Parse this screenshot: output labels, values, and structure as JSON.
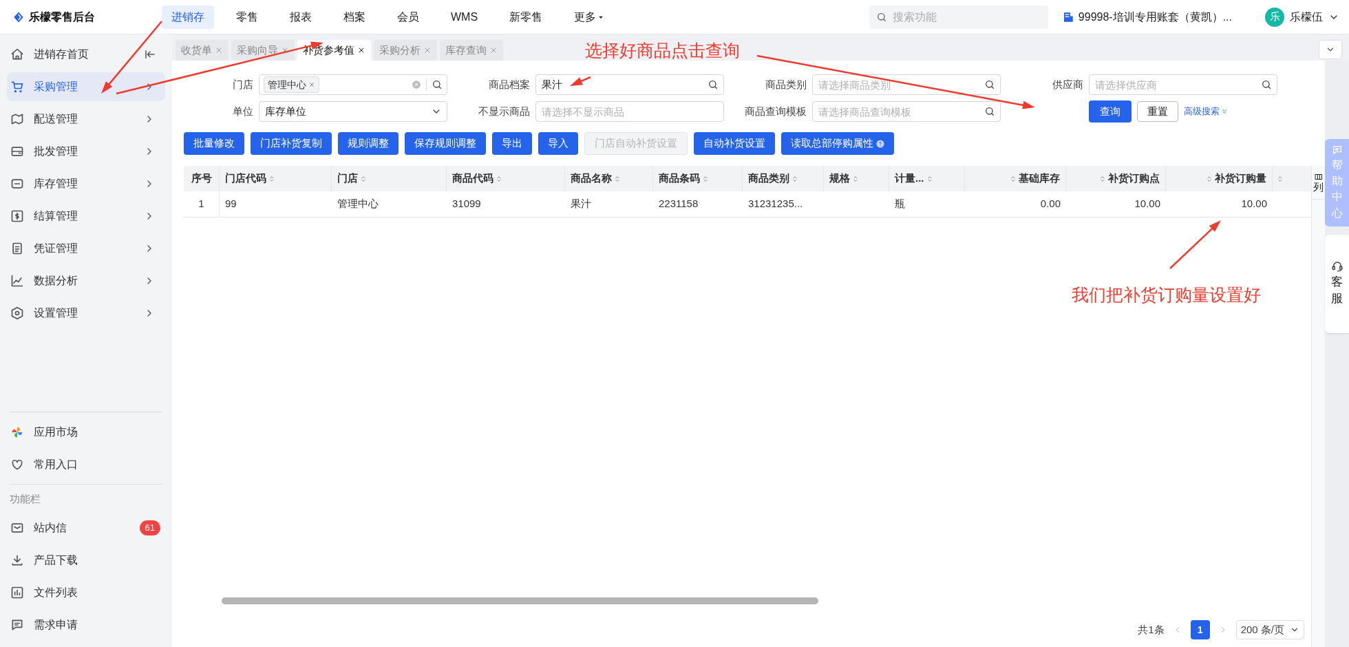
{
  "app": {
    "logo_text": "乐檬零售后台"
  },
  "top_nav": [
    {
      "label": "进销存",
      "selected": true,
      "kind": "link"
    },
    {
      "label": "零售",
      "selected": false,
      "kind": "link"
    },
    {
      "label": "报表",
      "selected": false,
      "kind": "link"
    },
    {
      "label": "档案",
      "selected": false,
      "kind": "link"
    },
    {
      "label": "会员",
      "selected": false,
      "kind": "link"
    },
    {
      "label": "WMS",
      "selected": false,
      "kind": "link"
    },
    {
      "label": "新零售",
      "selected": false,
      "kind": "link"
    },
    {
      "label": "更多",
      "selected": false,
      "kind": "dropdown"
    }
  ],
  "search": {
    "placeholder": "搜索功能"
  },
  "account": {
    "label": "99998-培训专用账套（黄凯）..."
  },
  "user": {
    "avatar_text": "乐",
    "name": "乐檬伍"
  },
  "sidebar": {
    "menu": [
      {
        "label": "进销存首页",
        "selected": false,
        "kind": "collapse"
      },
      {
        "label": "采购管理",
        "selected": true,
        "kind": "submenu"
      },
      {
        "label": "配送管理",
        "selected": false,
        "kind": "submenu"
      },
      {
        "label": "批发管理",
        "selected": false,
        "kind": "submenu"
      },
      {
        "label": "库存管理",
        "selected": false,
        "kind": "submenu"
      },
      {
        "label": "结算管理",
        "selected": false,
        "kind": "submenu"
      },
      {
        "label": "凭证管理",
        "selected": false,
        "kind": "submenu"
      },
      {
        "label": "数据分析",
        "selected": false,
        "kind": "submenu"
      },
      {
        "label": "设置管理",
        "selected": false,
        "kind": "submenu"
      }
    ],
    "apps": [
      {
        "label": "应用市场"
      },
      {
        "label": "常用入口"
      }
    ],
    "section_title": "功能栏",
    "tools": [
      {
        "label": "站内信",
        "badge": "61"
      },
      {
        "label": "产品下载"
      },
      {
        "label": "文件列表"
      },
      {
        "label": "需求申请"
      }
    ]
  },
  "tabs": [
    {
      "label": "收货单",
      "selected": false
    },
    {
      "label": "采购向导",
      "selected": false
    },
    {
      "label": "补货参考值",
      "selected": true
    },
    {
      "label": "采购分析",
      "selected": false
    },
    {
      "label": "库存查询",
      "selected": false
    }
  ],
  "filters": [
    {
      "label": "门店",
      "kind": "tags",
      "tags": [
        "管理中心"
      ]
    },
    {
      "label": "商品档案",
      "kind": "search",
      "value": "果汁"
    },
    {
      "label": "商品类别",
      "kind": "search",
      "placeholder": "请选择商品类别"
    },
    {
      "label": "供应商",
      "kind": "search",
      "placeholder": "请选择供应商"
    },
    {
      "label": "单位",
      "kind": "select",
      "value": "库存单位"
    },
    {
      "label": "不显示商品",
      "kind": "text",
      "placeholder": "请选择不显示商品"
    },
    {
      "label": "商品查询模板",
      "kind": "search",
      "placeholder": "请选择商品查询模板"
    }
  ],
  "query_buttons": [
    {
      "label": "查询",
      "kind": "primary"
    },
    {
      "label": "重置",
      "kind": "default"
    },
    {
      "label": "高级搜索",
      "kind": "link"
    }
  ],
  "toolbar": [
    {
      "label": "批量修改",
      "disabled": false,
      "kind": "plain"
    },
    {
      "label": "门店补货复制",
      "disabled": false,
      "kind": "plain"
    },
    {
      "label": "规则调整",
      "disabled": false,
      "kind": "plain"
    },
    {
      "label": "保存规则调整",
      "disabled": false,
      "kind": "plain"
    },
    {
      "label": "导出",
      "disabled": false,
      "kind": "plain"
    },
    {
      "label": "导入",
      "disabled": false,
      "kind": "plain"
    },
    {
      "label": "门店自动补货设置",
      "disabled": true,
      "kind": "plain"
    },
    {
      "label": "自动补货设置",
      "disabled": false,
      "kind": "plain"
    },
    {
      "label": "读取总部停购属性",
      "disabled": false,
      "kind": "info"
    }
  ],
  "table": {
    "columns": [
      {
        "label": "序号",
        "kind": "index",
        "sortable": false
      },
      {
        "label": "门店代码",
        "kind": "text",
        "sortable": true
      },
      {
        "label": "门店",
        "kind": "text",
        "sortable": true
      },
      {
        "label": "商品代码",
        "kind": "text",
        "sortable": true
      },
      {
        "label": "商品名称",
        "kind": "text",
        "sortable": true
      },
      {
        "label": "商品条码",
        "kind": "text",
        "sortable": true
      },
      {
        "label": "商品类别",
        "kind": "text",
        "sortable": true
      },
      {
        "label": "规格",
        "kind": "text",
        "sortable": true
      },
      {
        "label": "计量...",
        "kind": "text",
        "sortable": true
      },
      {
        "label": "基础库存",
        "kind": "number",
        "sortable": true
      },
      {
        "label": "补货订购点",
        "kind": "number",
        "sortable": true
      },
      {
        "label": "补货订购量",
        "kind": "number",
        "sortable": true
      }
    ],
    "rows": [
      [
        "1",
        "99",
        "管理中心",
        "31099",
        "果汁",
        "2231158",
        "31231235...",
        "",
        "瓶",
        "0.00",
        "10.00",
        "10.00"
      ]
    ]
  },
  "column_settings": {
    "label": "列"
  },
  "pagination": {
    "total": "共1条",
    "pages": [
      {
        "label": "1",
        "selected": true
      }
    ],
    "page_size": "200 条/页"
  },
  "side_help": {
    "help": "帮助中心",
    "service": "客服"
  },
  "annotations": [
    {
      "text": "选择好商品点击查询"
    },
    {
      "text": "我们把补货订购量设置好"
    }
  ]
}
